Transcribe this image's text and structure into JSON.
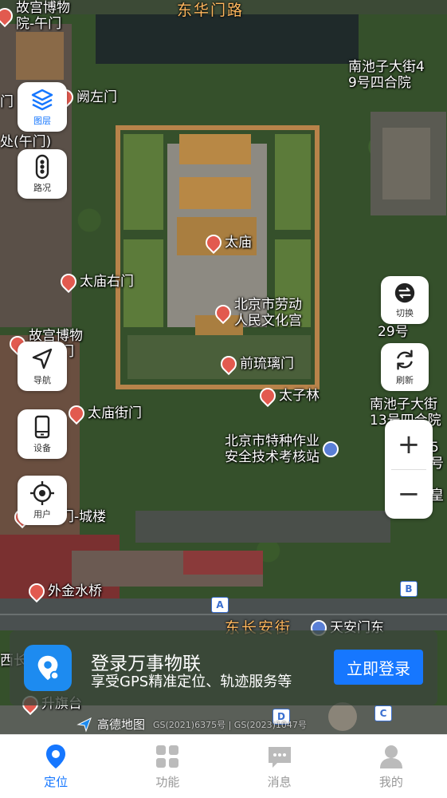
{
  "map": {
    "pois": [
      {
        "label": "故宫博物\n院-午门"
      },
      {
        "label": "阙左门"
      },
      {
        "label": "太庙"
      },
      {
        "label": "太庙右门"
      },
      {
        "label": "北京市劳动\n人民文化宫"
      },
      {
        "label": "故宫博物\n院-端门"
      },
      {
        "label": "前琉璃门"
      },
      {
        "label": "太子林"
      },
      {
        "label": "太庙街门"
      },
      {
        "label": "北京市特种作业\n安全技术考核站"
      },
      {
        "label": "天安门-城楼"
      },
      {
        "label": "外金水桥"
      },
      {
        "label": "升旗台"
      },
      {
        "label": "天安门东"
      }
    ],
    "labels": {
      "road_top": "东华门路",
      "road_changan": "东长安街",
      "nanchizi_49": "南池子大街4\n9号四合院",
      "wumen_office": "处(午门)",
      "men_left": "门",
      "num29": "29号",
      "nanchizi_13": "南池子大街\n13号四合院",
      "huang": "皇",
      "num_right": "5号",
      "xi_chang": "西长"
    },
    "road_markers": [
      "A",
      "B",
      "D",
      "C"
    ]
  },
  "left_buttons": [
    {
      "label": "图层",
      "icon": "layers-icon",
      "active": true
    },
    {
      "label": "路况",
      "icon": "traffic-light-icon",
      "active": false
    },
    {
      "label": "导航",
      "icon": "navigation-arrow-icon",
      "active": false
    },
    {
      "label": "设备",
      "icon": "phone-device-icon",
      "active": false
    },
    {
      "label": "用户",
      "icon": "locate-user-icon",
      "active": false
    }
  ],
  "right_buttons": [
    {
      "label": "切换",
      "icon": "switch-icon"
    },
    {
      "label": "刷新",
      "icon": "refresh-icon"
    }
  ],
  "zoom": {
    "in": "+",
    "out": "−"
  },
  "banner": {
    "title": "登录万事物联",
    "subtitle": "享受GPS精准定位、轨迹服务等",
    "login_button": "立即登录"
  },
  "attribution": {
    "brand": "高德地图",
    "copyright": "GS(2021)6375号 | GS(2023)1047号"
  },
  "tabs": [
    {
      "label": "定位",
      "icon": "location-pin-icon",
      "active": true
    },
    {
      "label": "功能",
      "icon": "grid-icon",
      "active": false
    },
    {
      "label": "消息",
      "icon": "message-icon",
      "active": false
    },
    {
      "label": "我的",
      "icon": "person-icon",
      "active": false
    }
  ],
  "colors": {
    "accent": "#1677ff",
    "poi_pin": "#e25a4f",
    "road_label": "#ffb75e"
  }
}
